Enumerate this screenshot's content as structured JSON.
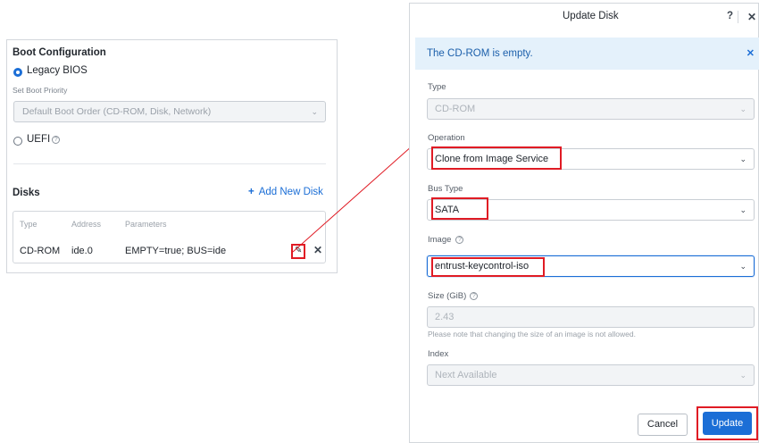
{
  "boot": {
    "title": "Boot Configuration",
    "legacy_label": "Legacy BIOS",
    "priority_label": "Set Boot Priority",
    "priority_value": "Default Boot Order (CD-ROM, Disk, Network)",
    "uefi_label": "UEFI",
    "help_glyph": "?",
    "selected_mode": "Legacy BIOS"
  },
  "disks": {
    "title": "Disks",
    "add_label": "Add New Disk",
    "add_glyph": "+",
    "columns": [
      "Type",
      "Address",
      "Parameters"
    ],
    "rows": [
      {
        "type": "CD-ROM",
        "address": "ide.0",
        "parameters": "EMPTY=true; BUS=ide"
      }
    ],
    "edit_icon": "pencil-icon",
    "delete_glyph": "✕"
  },
  "dialog": {
    "title": "Update Disk",
    "help_glyph": "?",
    "close_glyph": "✕",
    "banner_text": "The CD-ROM is empty.",
    "banner_close": "✕",
    "type_label": "Type",
    "type_value": "CD-ROM",
    "operation_label": "Operation",
    "operation_value": "Clone from Image Service",
    "bus_label": "Bus Type",
    "bus_value": "SATA",
    "image_label": "Image",
    "image_value": "entrust-keycontrol-iso",
    "size_label": "Size (GiB)",
    "size_value": "2.43",
    "size_note": "Please note that changing the size of an image is not allowed.",
    "index_label": "Index",
    "index_value": "Next Available",
    "cancel_label": "Cancel",
    "update_label": "Update"
  },
  "colors": {
    "accent": "#1b6ed6",
    "highlight": "#e01b24",
    "banner_bg": "#e4f1fb"
  }
}
